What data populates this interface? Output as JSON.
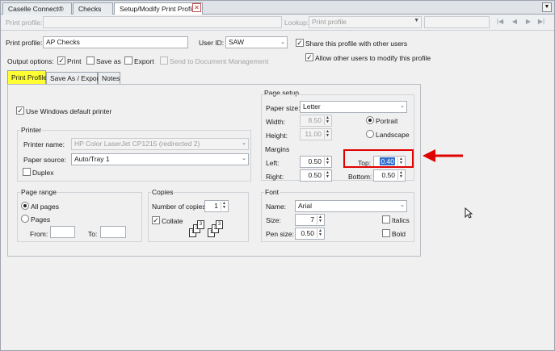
{
  "tabs": [
    {
      "label": "Caselle Connect®"
    },
    {
      "label": "Checks"
    },
    {
      "label": "Setup/Modify Print Profiles"
    }
  ],
  "lookup_bar": {
    "print_profile_label": "Print profile:",
    "lookup_label": "Lookup:",
    "lookup_value": "Print profile"
  },
  "form": {
    "print_profile_label": "Print profile:",
    "print_profile_value": "AP Checks",
    "user_id_label": "User ID:",
    "user_id_value": "SAW",
    "share_label": "Share this profile with other users",
    "allow_modify_label": "Allow other users to modify this profile",
    "output_options_label": "Output options:",
    "opt_print": "Print",
    "opt_save_as": "Save as",
    "opt_export": "Export",
    "opt_docmgmt": "Send to Document Management"
  },
  "inner_tabs": [
    "Print Profile",
    "Save As / Export",
    "Notes"
  ],
  "printer": {
    "use_default_label": "Use Windows default printer",
    "group_title": "Printer",
    "name_label": "Printer name:",
    "name_value": "HP Color LaserJet CP1215 (redirected 2)",
    "source_label": "Paper source:",
    "source_value": "Auto/Tray 1",
    "duplex_label": "Duplex"
  },
  "page_range": {
    "title": "Page range",
    "all_pages": "All pages",
    "pages": "Pages",
    "from_label": "From:",
    "to_label": "To:"
  },
  "copies": {
    "title": "Copies",
    "number_label": "Number of copies:",
    "number_value": "1",
    "collate_label": "Collate"
  },
  "page_setup": {
    "title": "Page setup",
    "paper_size_label": "Paper size:",
    "paper_size_value": "Letter",
    "width_label": "Width:",
    "width_value": "8.50",
    "height_label": "Height:",
    "height_value": "11.00",
    "portrait": "Portrait",
    "landscape": "Landscape",
    "margins_title": "Margins",
    "left_label": "Left:",
    "left_value": "0.50",
    "top_label": "Top:",
    "top_value": "0.40",
    "right_label": "Right:",
    "right_value": "0.50",
    "bottom_label": "Bottom:",
    "bottom_value": "0.50"
  },
  "font": {
    "title": "Font",
    "name_label": "Name:",
    "name_value": "Arial",
    "size_label": "Size:",
    "size_value": "7",
    "pen_label": "Pen size:",
    "pen_value": "0.50",
    "italics_label": "Italics",
    "bold_label": "Bold"
  },
  "colors": {
    "selected_tab": "#ffff33",
    "highlight_box": "#e00000",
    "arrow": "#e00000"
  }
}
